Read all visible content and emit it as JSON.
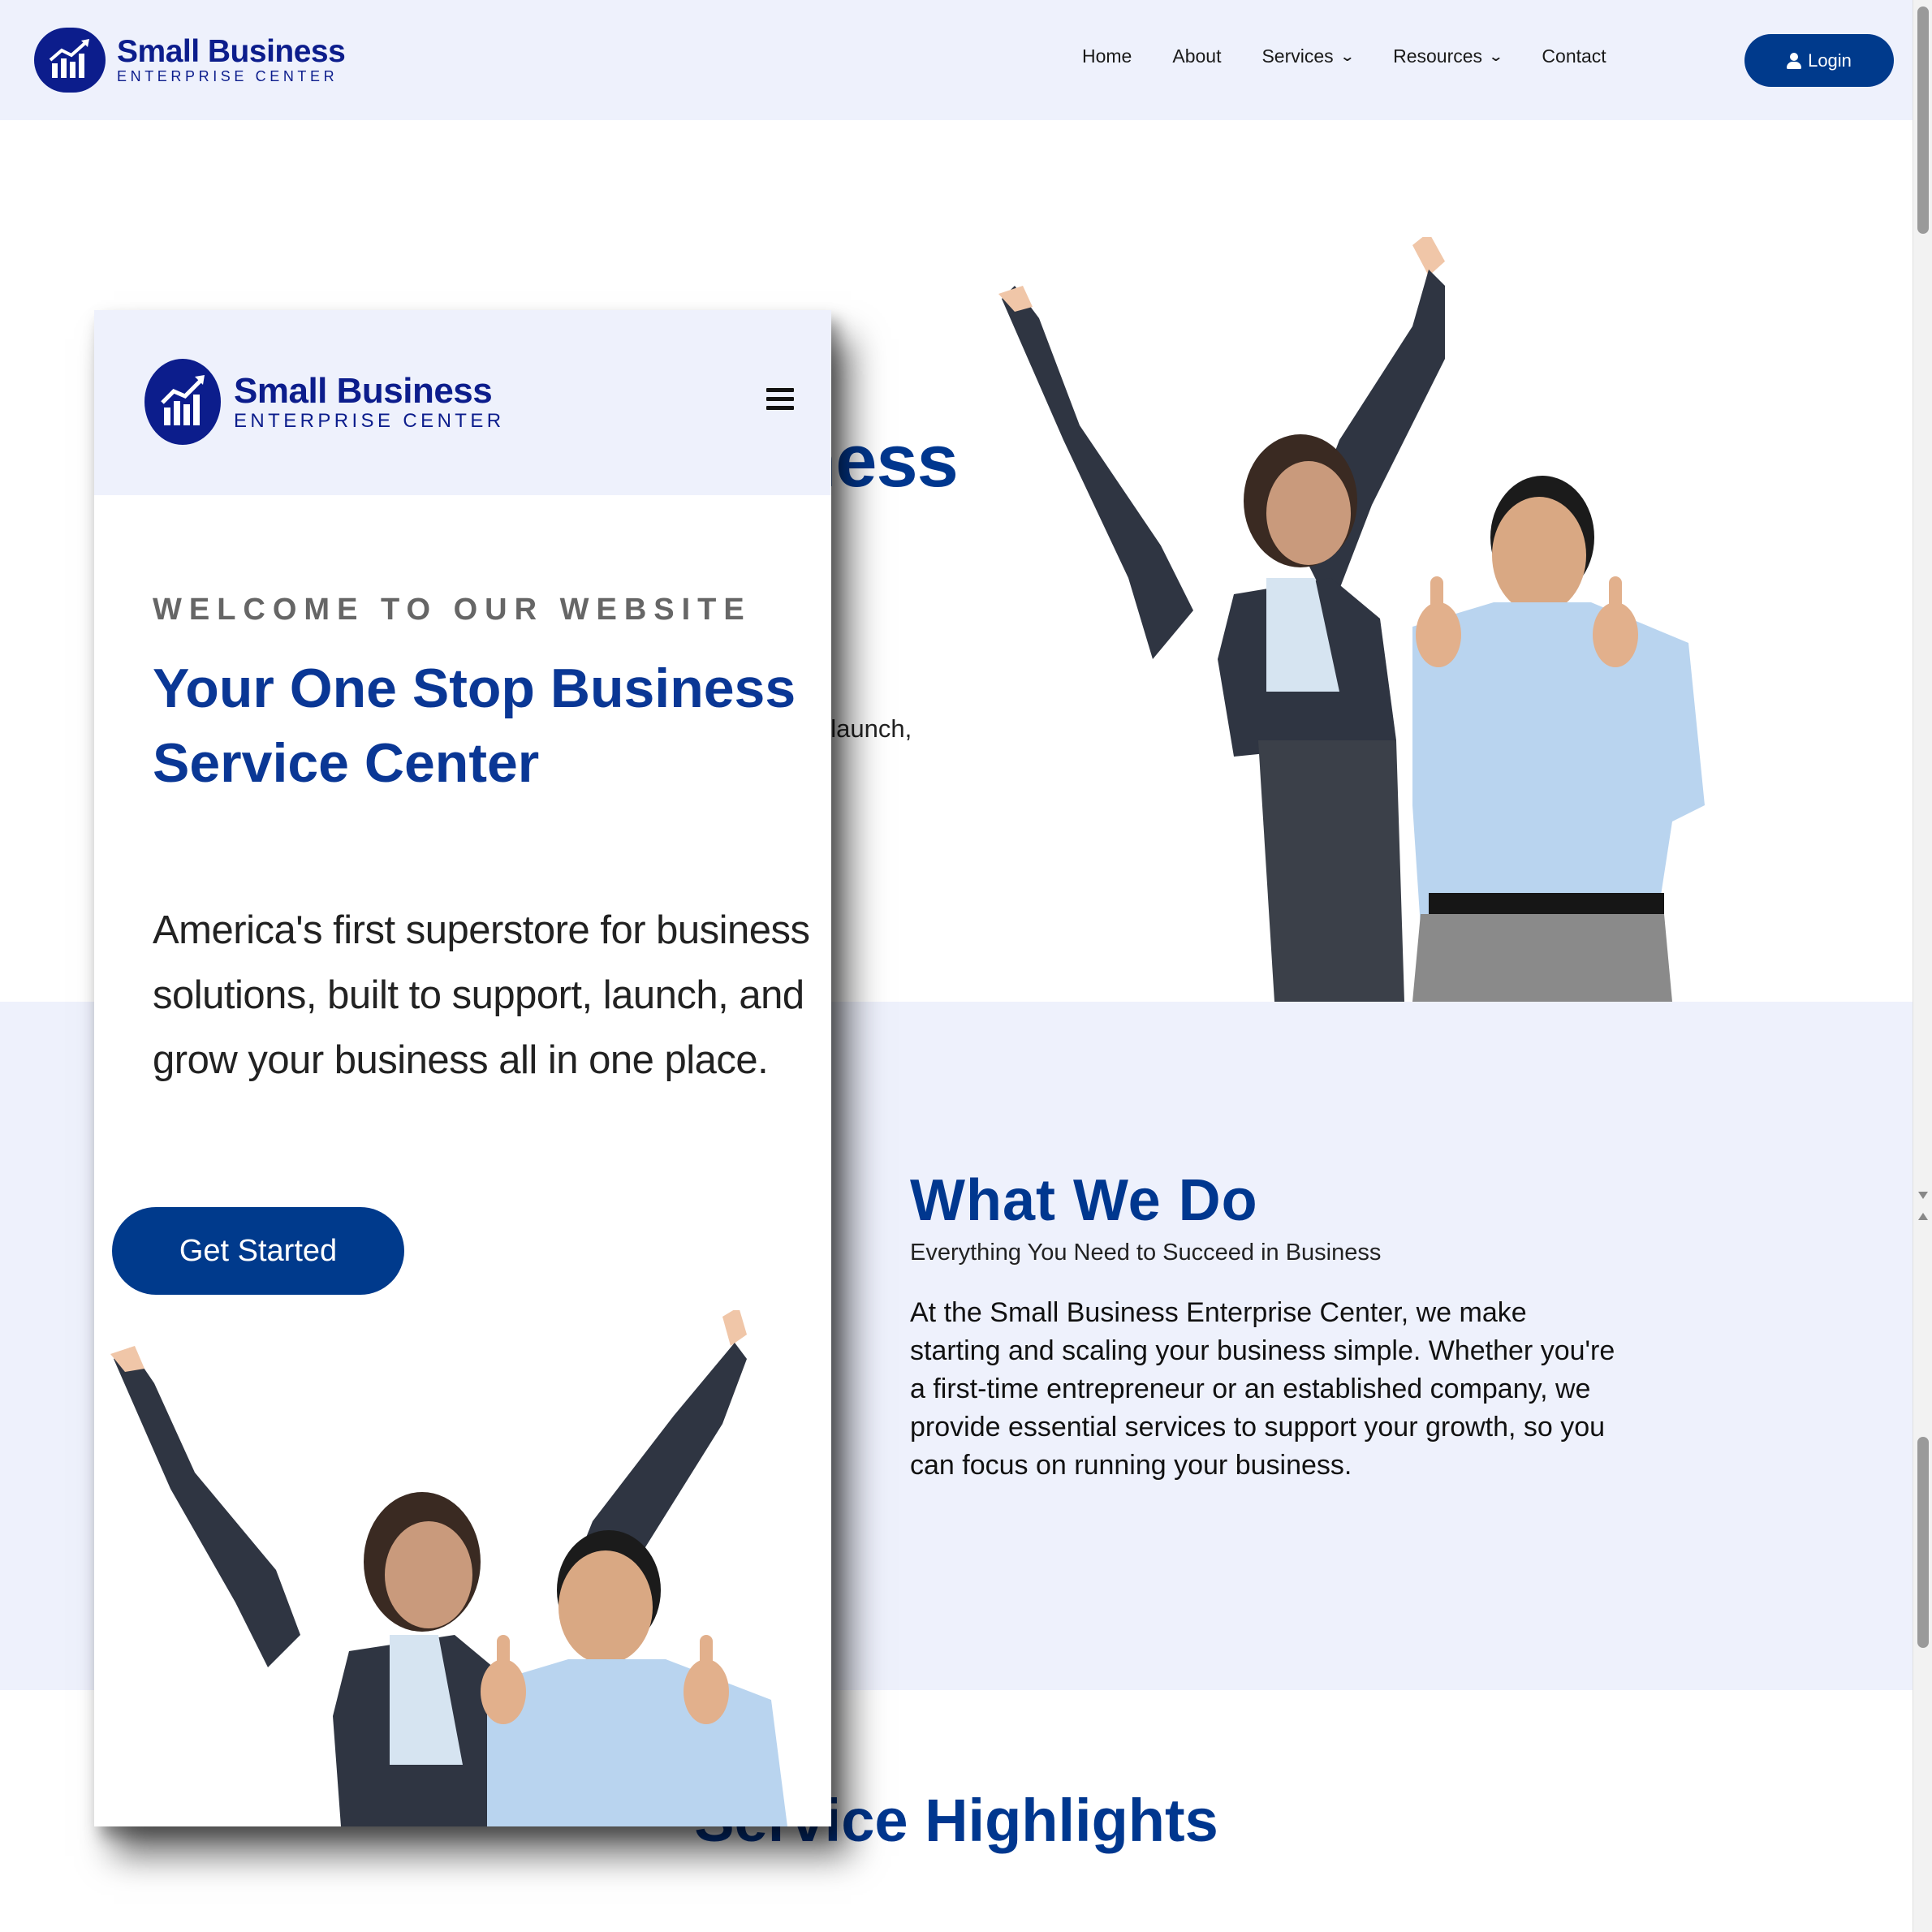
{
  "brand": {
    "name": "Small Business",
    "tagline": "ENTERPRISE CENTER",
    "color": "#0c1d8c",
    "accent": "#00378f"
  },
  "nav": {
    "items": [
      {
        "label": "Home"
      },
      {
        "label": "About"
      },
      {
        "label": "Services",
        "icon": "chevron-down-icon"
      },
      {
        "label": "Resources",
        "icon": "chevron-down-icon"
      },
      {
        "label": "Contact"
      }
    ],
    "login_label": "Login"
  },
  "hero": {
    "eyebrow": "WELCOME TO OUR WEBSITE",
    "title": "Your One Stop Business Service Center",
    "body": "America's first superstore for business solutions, built to support, launch, and grow your business all in one place.",
    "cta_label": "Get Started"
  },
  "what_we_do": {
    "title": "What We Do",
    "subtitle": "Everything You Need to Succeed in Business",
    "body": "At the Small Business Enterprise Center, we make starting and scaling your business simple. Whether you're a first-time entrepreneur or an established company, we provide essential services to support your growth, so you can focus on running your business."
  },
  "service_highlights": {
    "title": "Service Highlights"
  },
  "icons": {
    "menu": "hamburger-menu-icon",
    "user": "user-icon",
    "logo": "bar-chart-logo-icon"
  }
}
